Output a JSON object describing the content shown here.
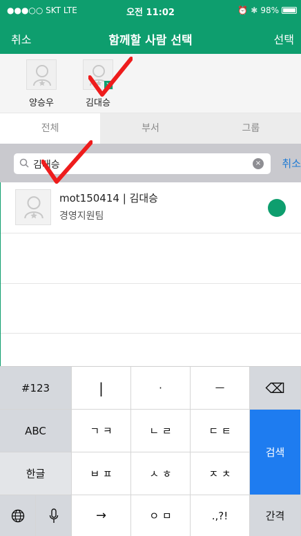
{
  "status": {
    "carrier": "●●●○○ SKT  LTE",
    "time": "오전 11:02",
    "battery": "98%",
    "battery_level": 0.98
  },
  "nav": {
    "cancel": "취소",
    "title": "함께할 사람 선택",
    "select": "선택"
  },
  "chips": [
    {
      "name": "양승우"
    },
    {
      "name": "김대승",
      "remove": "×"
    }
  ],
  "tabs": [
    {
      "label": "전체",
      "active": true
    },
    {
      "label": "부서"
    },
    {
      "label": "그룹"
    }
  ],
  "search": {
    "value": "김대승",
    "clear": "×",
    "cancel": "취소"
  },
  "results": [
    {
      "title": "mot150414 | 김대승",
      "subtitle": "경영지원팀",
      "status_color": "#0e9e6e"
    }
  ],
  "keyboard": {
    "symbols": "#123",
    "abc": "ABC",
    "hangul": "한글",
    "row1": [
      "|",
      "·",
      "ㅡ"
    ],
    "row2": [
      "ㄱ ㅋ",
      "ㄴ ㄹ",
      "ㄷ ㅌ"
    ],
    "row3": [
      "ㅂ ㅍ",
      "ㅅ ㅎ",
      "ㅈ ㅊ"
    ],
    "row4": [
      "→",
      "ㅇ ㅁ",
      ".,?!"
    ],
    "search": "검색",
    "space": "간격",
    "backspace": "⌫"
  },
  "colors": {
    "accent": "#0e9e6e",
    "blue": "#1e7cf0",
    "annotation": "#ee1c1c"
  }
}
